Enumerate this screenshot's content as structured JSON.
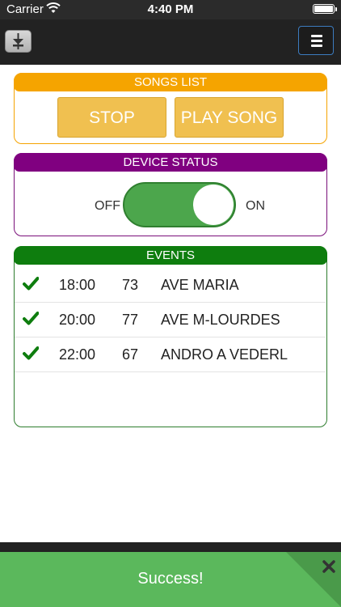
{
  "status_bar": {
    "carrier": "Carrier",
    "time": "4:40 PM"
  },
  "navbar": {
    "app_icon": "fader-icon",
    "menu_icon": "hamburger-menu-icon"
  },
  "songs_panel": {
    "title": "SONGS LIST",
    "stop_label": "STOP",
    "play_label": "PLAY SONG",
    "color": "#f5a400"
  },
  "device_panel": {
    "title": "DEVICE STATUS",
    "off_label": "OFF",
    "on_label": "ON",
    "toggle_on": true,
    "color": "#800080"
  },
  "events_panel": {
    "title": "EVENTS",
    "color": "#0e7d0e",
    "rows": [
      {
        "time": "18:00",
        "number": "73",
        "song": "AVE MARIA",
        "checked": true
      },
      {
        "time": "20:00",
        "number": "77",
        "song": "AVE M-LOURDES",
        "checked": true
      },
      {
        "time": "22:00",
        "number": "67",
        "song": "ANDRO A VEDERL",
        "checked": true
      }
    ]
  },
  "toast": {
    "message": "Success!",
    "color": "#5bb85c",
    "close_icon": "close-icon"
  }
}
